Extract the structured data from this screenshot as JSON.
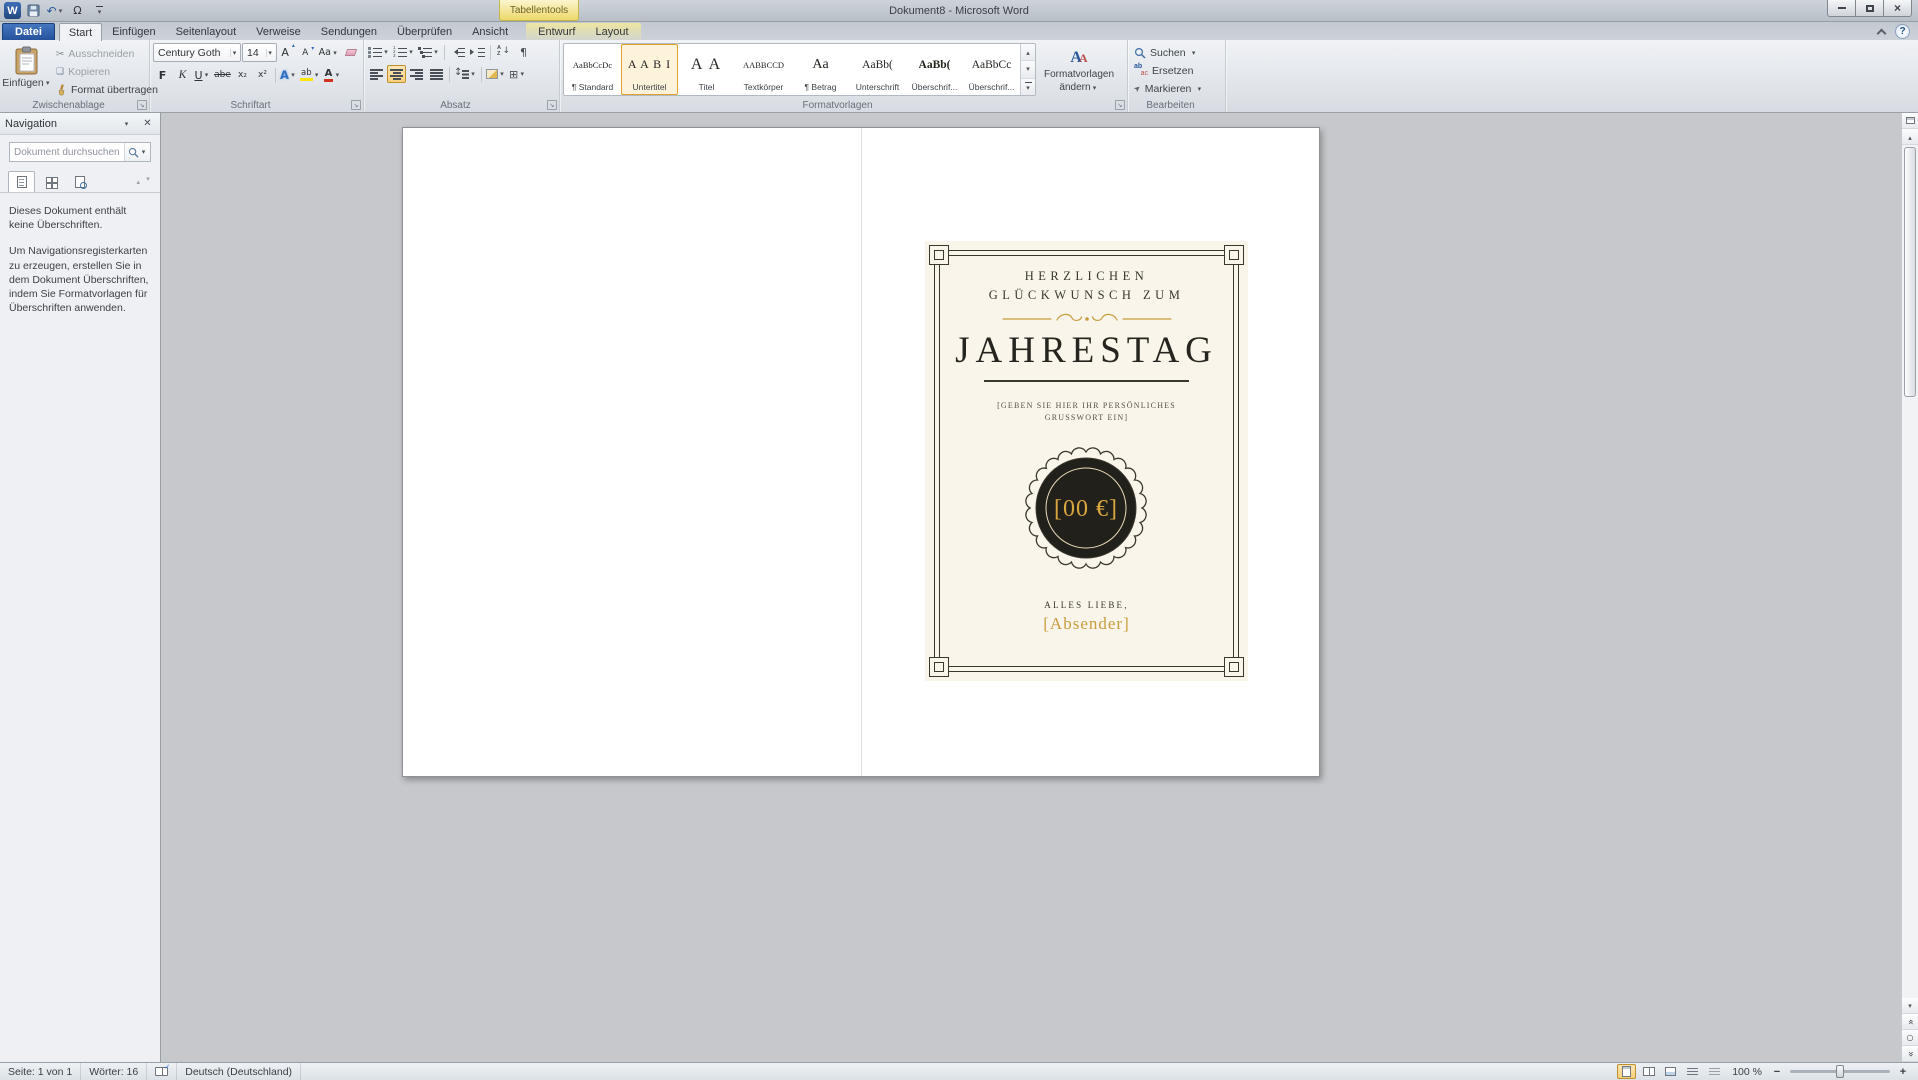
{
  "titlebar": {
    "contextual_label": "Tabellentools",
    "title": "Dokument8 - Microsoft Word"
  },
  "tabs": {
    "file": "Datei",
    "items": [
      "Start",
      "Einfügen",
      "Seitenlayout",
      "Verweise",
      "Sendungen",
      "Überprüfen",
      "Ansicht"
    ],
    "contextual": [
      "Entwurf",
      "Layout"
    ]
  },
  "ribbon": {
    "clipboard": {
      "label": "Zwischenablage",
      "paste": "Einfügen",
      "cut": "Ausschneiden",
      "copy": "Kopieren",
      "painter": "Format übertragen"
    },
    "font": {
      "label": "Schriftart",
      "family": "Century Goth",
      "size": "14"
    },
    "paragraph": {
      "label": "Absatz"
    },
    "styles": {
      "label": "Formatvorlagen",
      "change_line1": "Formatvorlagen",
      "change_line2": "ändern",
      "items": [
        {
          "preview": "AaBbCcDc",
          "name": "¶ Standard"
        },
        {
          "preview": "A A B I",
          "name": "Untertitel"
        },
        {
          "preview": "A A",
          "name": "Titel"
        },
        {
          "preview": "AABBCCD",
          "name": "Textkörper"
        },
        {
          "preview": "Aa",
          "name": "¶ Betrag"
        },
        {
          "preview": "AaBb(",
          "name": "Unterschrift"
        },
        {
          "preview": "AaBb(",
          "name": "Überschrif..."
        },
        {
          "preview": "AaBbCc",
          "name": "Überschrif..."
        }
      ]
    },
    "editing": {
      "label": "Bearbeiten",
      "find": "Suchen",
      "replace": "Ersetzen",
      "select": "Markieren"
    }
  },
  "navigation": {
    "title": "Navigation",
    "search_placeholder": "Dokument durchsuchen",
    "message_no_headings": "Dieses Dokument enthält keine Überschriften.",
    "message_help": "Um Navigationsregisterkarten zu erzeugen, erstellen Sie in dem Dokument Überschriften, indem Sie Formatvorlagen für Überschriften anwenden."
  },
  "card": {
    "heading_line1": "HERZLICHEN",
    "heading_line2": "GLÜCKWUNSCH ZUM",
    "title": "JAHRESTAG",
    "note_line1": "[GEBEN SIE HIER IHR PERSÖNLICHES",
    "note_line2": "GRUSSWORT EIN]",
    "amount": "[00 €]",
    "closing": "ALLES LIEBE,",
    "sender": "[Absender]"
  },
  "statusbar": {
    "page": "Seite: 1 von 1",
    "words": "Wörter: 16",
    "language": "Deutsch (Deutschland)",
    "zoom": "100 %"
  },
  "colors": {
    "accent_gold": "#c99d3f",
    "seal_background": "#22201b",
    "file_tab_blue": "#2a579a",
    "selection_orange": "#e0a12c",
    "contextual_tab_yellow": "#ecd96a"
  },
  "icons": {
    "save": "floppy-disk",
    "undo": "↶",
    "symbol": "Ω",
    "cut": "✂",
    "copy": "❏",
    "format_painter": "paint-brush",
    "bold": "F",
    "italic": "K",
    "underline": "U",
    "strikethrough": "abe",
    "subscript": "x₂",
    "superscript": "x²",
    "change_case": "Aa",
    "grow_font": "A",
    "shrink_font": "A",
    "text_effects": "A",
    "highlight": "ab",
    "font_color": "A",
    "paragraph_mark": "¶",
    "borders": "⊞",
    "search": "magnifier",
    "select_arrow": "➤"
  }
}
